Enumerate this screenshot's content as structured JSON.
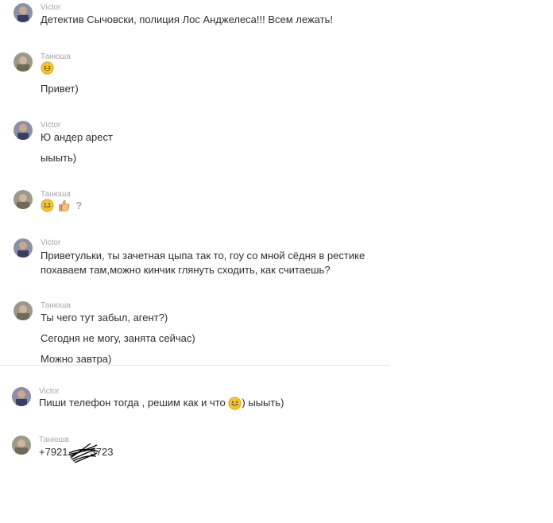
{
  "messages": [
    {
      "author": "Victor",
      "lines": [
        "Детектив Сычовски, полиция Лос Анджелеса!!! Всем лежать!"
      ]
    },
    {
      "author": "Танюша",
      "emoji_line": [
        "smile-emoji"
      ],
      "lines": [
        "Привет)"
      ]
    },
    {
      "author": "Victor",
      "lines": [
        "Ю андер арест",
        "ыыыть)"
      ]
    },
    {
      "author": "Танюша",
      "emoji_line": [
        "smile-emoji",
        "thumbs-up-emoji",
        "question-mark"
      ],
      "question": "?"
    },
    {
      "author": "Victor",
      "lines": [
        "Приветульки, ты зачетная цыпа так то, гоу со мной сёдня в рестике похаваем там,можно кинчик глянуть сходить, как считаешь?"
      ]
    },
    {
      "author": "Танюша",
      "lines": [
        "Ты чего тут забыл, агент?)",
        "Сегодня не могу, занята сейчас)",
        "Можно завтра)"
      ]
    },
    {
      "author": "Victor",
      "line_before_emoji": "Пиши телефон тогда , решим как и что",
      "line_after_emoji": ") ыыыть)"
    },
    {
      "author": "Танюша",
      "phone_start": "+7921",
      "phone_end": "3723"
    }
  ],
  "colors": {
    "author": "#a6a6a6",
    "text": "#2e2e2e",
    "divider": "#e0e0e0",
    "emoji": "#f4c430"
  }
}
